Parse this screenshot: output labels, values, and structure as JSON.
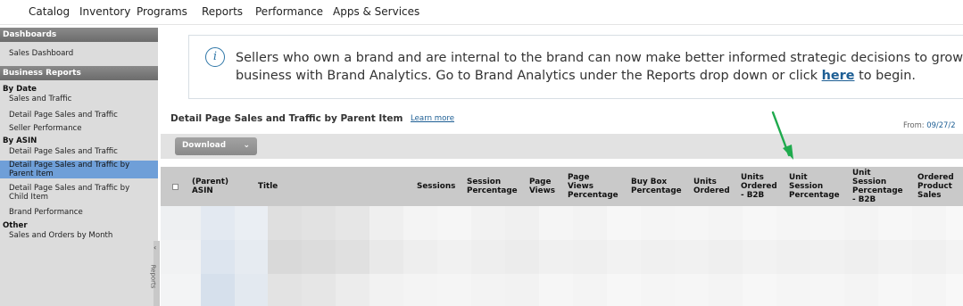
{
  "topnav": {
    "items": [
      "Catalog",
      "Inventory",
      "Programs",
      "Reports",
      "Performance",
      "Apps & Services"
    ]
  },
  "sidebar": {
    "dashboards_header": "Dashboards",
    "sales_dashboard": "Sales Dashboard",
    "business_reports_header": "Business Reports",
    "by_date_label": "By Date",
    "by_date_items": [
      "Sales and Traffic",
      "Detail Page Sales and Traffic",
      "Seller Performance"
    ],
    "by_asin_label": "By ASIN",
    "by_asin_items": [
      "Detail Page Sales and Traffic",
      "Detail Page Sales and Traffic by",
      "Parent Item",
      "Detail Page Sales and Traffic by",
      "Child Item",
      "Brand Performance"
    ],
    "other_label": "Other",
    "other_items": [
      "Sales and Orders by Month"
    ],
    "collapse_tab_label": "Reports"
  },
  "banner": {
    "message_before_link": "Sellers who own a brand and are internal to the brand can now make better informed strategic decisions to grow their business with Brand Analytics. Go to Brand Analytics under the Reports drop down or click",
    "link_text": "here",
    "message_after_link": "to begin."
  },
  "report": {
    "title": "Detail Page Sales and Traffic by Parent Item",
    "learn_more": "Learn more",
    "date_from_label": "From:",
    "date_from_value": "09/27/2"
  },
  "toolbar": {
    "download_label": "Download"
  },
  "table": {
    "columns": [
      [
        "(Parent)",
        "ASIN"
      ],
      [
        "Title"
      ],
      [
        "Sessions"
      ],
      [
        "Session",
        "Percentage"
      ],
      [
        "Page",
        "Views"
      ],
      [
        "Page",
        "Views",
        "Percentage"
      ],
      [
        "Buy Box",
        "Percentage"
      ],
      [
        "Units",
        "Ordered"
      ],
      [
        "Units",
        "Ordered",
        "- B2B"
      ],
      [
        "Unit",
        "Session",
        "Percentage"
      ],
      [
        "Unit",
        "Session",
        "Percentage",
        "- B2B"
      ],
      [
        "Ordered",
        "Product",
        "Sales"
      ]
    ]
  },
  "colors": {
    "sidebar_bg": "#dcdcdc",
    "sidebar_active": "#6f9fd8",
    "header_gray": "#c9c9c9",
    "link_blue": "#1d5e94",
    "arrow_green": "#1faa4d"
  },
  "icons": [
    "info-icon",
    "chevron-down-icon",
    "chevron-left-icon",
    "annotation-arrow-icon"
  ]
}
